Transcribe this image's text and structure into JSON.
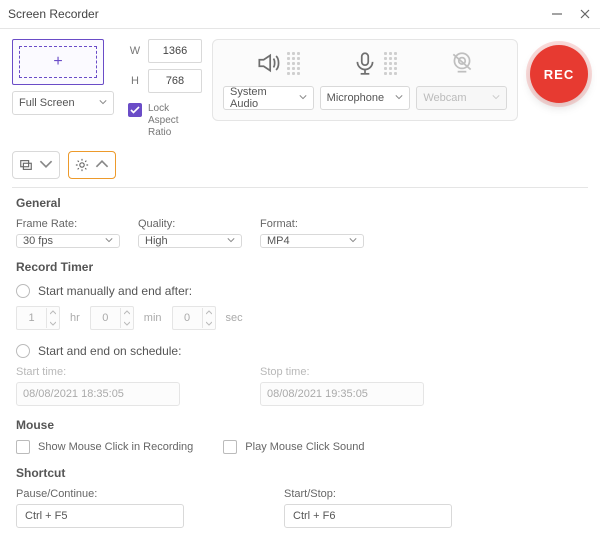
{
  "window": {
    "title": "Screen Recorder"
  },
  "capture": {
    "width": "1366",
    "height": "768",
    "mode": "Full Screen",
    "lock_aspect_label": "Lock Aspect Ratio"
  },
  "dim_labels": {
    "w": "W",
    "h": "H"
  },
  "sources": {
    "audio": "System Audio",
    "mic": "Microphone",
    "webcam": "Webcam"
  },
  "rec_label": "REC",
  "settings": {
    "general": {
      "title": "General",
      "frame_rate_label": "Frame Rate:",
      "frame_rate": "30 fps",
      "quality_label": "Quality:",
      "quality": "High",
      "format_label": "Format:",
      "format": "MP4"
    },
    "timer": {
      "title": "Record Timer",
      "manual_label": "Start manually and end after:",
      "hr": "1",
      "hr_unit": "hr",
      "min": "0",
      "min_unit": "min",
      "sec": "0",
      "sec_unit": "sec",
      "schedule_label": "Start and end on schedule:",
      "start_label": "Start time:",
      "start_value": "08/08/2021 18:35:05",
      "stop_label": "Stop time:",
      "stop_value": "08/08/2021 19:35:05"
    },
    "mouse": {
      "title": "Mouse",
      "show_click": "Show Mouse Click in Recording",
      "play_sound": "Play Mouse Click Sound"
    },
    "shortcut": {
      "title": "Shortcut",
      "pause_label": "Pause/Continue:",
      "pause_value": "Ctrl + F5",
      "start_label": "Start/Stop:",
      "start_value": "Ctrl + F6"
    }
  }
}
